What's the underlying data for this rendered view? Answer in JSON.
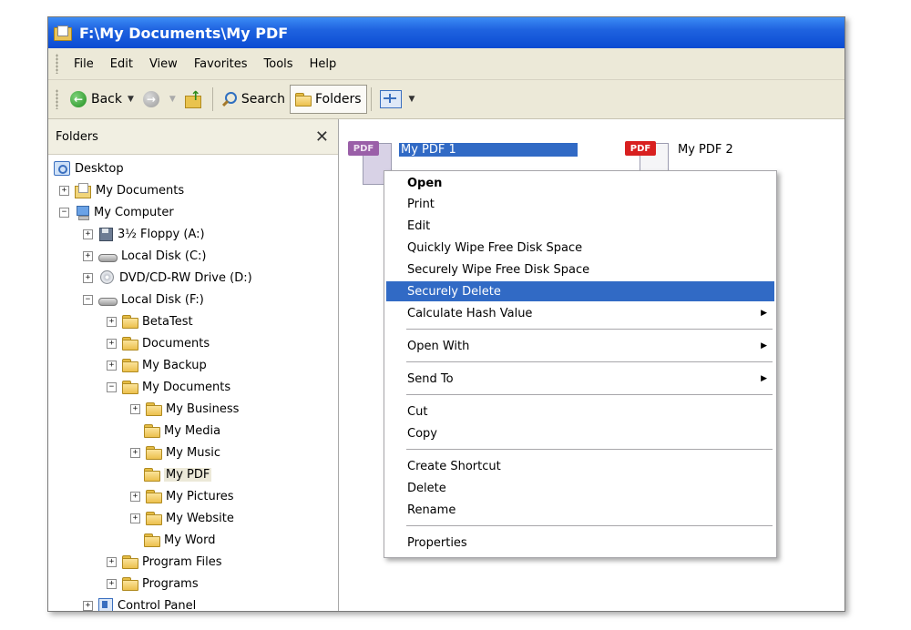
{
  "window": {
    "title": "F:\\My Documents\\My PDF"
  },
  "menubar": {
    "items": [
      "File",
      "Edit",
      "View",
      "Favorites",
      "Tools",
      "Help"
    ]
  },
  "toolbar": {
    "back_label": "Back",
    "search_label": "Search",
    "folders_label": "Folders"
  },
  "folders_pane": {
    "title": "Folders",
    "items": [
      "Desktop",
      "My Documents",
      "My Computer",
      "3½ Floppy (A:)",
      "Local Disk (C:)",
      "DVD/CD-RW Drive (D:)",
      "Local Disk (F:)",
      "BetaTest",
      "Documents",
      "My Backup",
      "My Documents",
      "My Business",
      "My Media",
      "My Music",
      "My PDF",
      "My Pictures",
      "My Website",
      "My Word",
      "Program Files",
      "Programs",
      "Control Panel"
    ]
  },
  "files": [
    {
      "name": "My PDF 1",
      "badge": "PDF"
    },
    {
      "name": "My PDF 2",
      "badge": "PDF"
    }
  ],
  "context_menu": {
    "items": [
      "Open",
      "Print",
      "Edit",
      "Quickly Wipe Free Disk Space",
      "Securely Wipe Free Disk Space",
      "Securely Delete",
      "Calculate Hash Value",
      "Open With",
      "Send To",
      "Cut",
      "Copy",
      "Create Shortcut",
      "Delete",
      "Rename",
      "Properties"
    ],
    "highlighted": "Securely Delete"
  },
  "colors": {
    "titlebar": "#0b4bd2",
    "selection": "#316ac5",
    "chrome": "#ece9d8",
    "pdf_badge": "#d82020"
  }
}
